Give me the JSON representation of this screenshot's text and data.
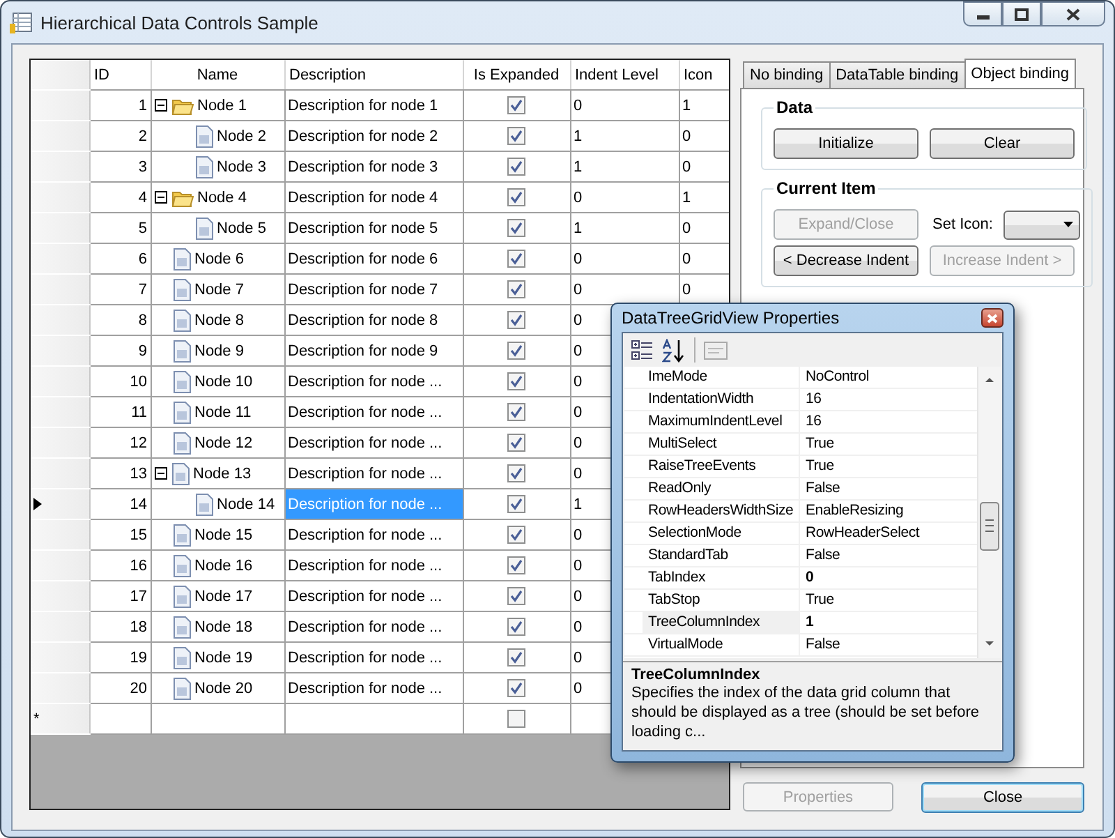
{
  "window": {
    "title": "Hierarchical Data Controls Sample"
  },
  "grid": {
    "columns": [
      "ID",
      "Name",
      "Description",
      "Is Expanded",
      "Indent Level",
      "Icon"
    ],
    "rows": [
      {
        "id": "1",
        "name": "Node 1",
        "kind": "folder",
        "expanded": true,
        "description": "Description for node 1",
        "is_expanded": true,
        "indent_level": "0",
        "icon": "1",
        "selected": false,
        "children": [
          {
            "id": "2",
            "name": "Node 2",
            "kind": "document",
            "description": "Description for node 2",
            "is_expanded": true,
            "indent_level": "1",
            "icon": "0",
            "selected": false
          },
          {
            "id": "3",
            "name": "Node 3",
            "kind": "document",
            "description": "Description for node 3",
            "is_expanded": true,
            "indent_level": "1",
            "icon": "0",
            "selected": false
          }
        ]
      },
      {
        "id": "4",
        "name": "Node 4",
        "kind": "folder",
        "expanded": true,
        "description": "Description for node 4",
        "is_expanded": true,
        "indent_level": "0",
        "icon": "1",
        "selected": false,
        "children": [
          {
            "id": "5",
            "name": "Node 5",
            "kind": "document",
            "description": "Description for node 5",
            "is_expanded": true,
            "indent_level": "1",
            "icon": "0",
            "selected": false
          }
        ]
      },
      {
        "id": "6",
        "name": "Node 6",
        "kind": "document",
        "description": "Description for node 6",
        "is_expanded": true,
        "indent_level": "0",
        "icon": "0",
        "selected": false
      },
      {
        "id": "7",
        "name": "Node 7",
        "kind": "document",
        "description": "Description for node 7",
        "is_expanded": true,
        "indent_level": "0",
        "icon": "0",
        "selected": false
      },
      {
        "id": "8",
        "name": "Node 8",
        "kind": "document",
        "description": "Description for node 8",
        "is_expanded": true,
        "indent_level": "0",
        "selected": false
      },
      {
        "id": "9",
        "name": "Node 9",
        "kind": "document",
        "description": "Description for node 9",
        "is_expanded": true,
        "indent_level": "0",
        "selected": false
      },
      {
        "id": "10",
        "name": "Node 10",
        "kind": "document",
        "description": "Description for node ...",
        "is_expanded": true,
        "indent_level": "0",
        "selected": false
      },
      {
        "id": "11",
        "name": "Node 11",
        "kind": "document",
        "description": "Description for node ...",
        "is_expanded": true,
        "indent_level": "0",
        "selected": false
      },
      {
        "id": "12",
        "name": "Node 12",
        "kind": "document",
        "description": "Description for node ...",
        "is_expanded": true,
        "indent_level": "0",
        "selected": false
      },
      {
        "id": "13",
        "name": "Node 13",
        "kind": "document",
        "expanded": true,
        "description": "Description for node ...",
        "is_expanded": true,
        "indent_level": "0",
        "selected": false,
        "children": [
          {
            "id": "14",
            "name": "Node 14",
            "kind": "document",
            "description": "Description for node ...",
            "is_expanded": true,
            "indent_level": "1",
            "selected": true
          }
        ]
      },
      {
        "id": "15",
        "name": "Node 15",
        "kind": "document",
        "description": "Description for node ...",
        "is_expanded": true,
        "indent_level": "0",
        "selected": false
      },
      {
        "id": "16",
        "name": "Node 16",
        "kind": "document",
        "description": "Description for node ...",
        "is_expanded": true,
        "indent_level": "0",
        "selected": false
      },
      {
        "id": "17",
        "name": "Node 17",
        "kind": "document",
        "description": "Description for node ...",
        "is_expanded": true,
        "indent_level": "0",
        "selected": false
      },
      {
        "id": "18",
        "name": "Node 18",
        "kind": "document",
        "description": "Description for node ...",
        "is_expanded": true,
        "indent_level": "0",
        "selected": false
      },
      {
        "id": "19",
        "name": "Node 19",
        "kind": "document",
        "description": "Description for node ...",
        "is_expanded": true,
        "indent_level": "0",
        "selected": false
      },
      {
        "id": "20",
        "name": "Node 20",
        "kind": "document",
        "description": "Description for node ...",
        "is_expanded": true,
        "indent_level": "0",
        "selected": false
      }
    ],
    "new_row": {
      "marker": "*",
      "is_expanded": false
    }
  },
  "tabs": [
    {
      "label": "No binding",
      "selected": false
    },
    {
      "label": "DataTable binding",
      "selected": false
    },
    {
      "label": "Object binding",
      "selected": true
    }
  ],
  "data_group": {
    "title": "Data",
    "buttons": [
      {
        "label": "Initialize",
        "disabled": false
      },
      {
        "label": "Clear",
        "disabled": false
      }
    ]
  },
  "current_item_group": {
    "title": "Current Item",
    "expand_button": {
      "label": "Expand/Close",
      "disabled": true
    },
    "set_icon_label": "Set Icon:",
    "decrease_button": {
      "label": "< Decrease Indent",
      "disabled": false
    },
    "increase_button": {
      "label": "Increase Indent >",
      "disabled": true
    }
  },
  "footer_buttons": [
    {
      "label": "Properties",
      "disabled": true
    },
    {
      "label": "Close",
      "disabled": false
    }
  ],
  "properties_window": {
    "title": "DataTreeGridView Properties",
    "properties": [
      {
        "name": "ImeMode",
        "value": "NoControl",
        "modified": false,
        "selected": false
      },
      {
        "name": "IndentationWidth",
        "value": "16",
        "modified": false,
        "selected": false
      },
      {
        "name": "MaximumIndentLevel",
        "value": "16",
        "modified": false,
        "selected": false
      },
      {
        "name": "MultiSelect",
        "value": "True",
        "modified": false,
        "selected": false
      },
      {
        "name": "RaiseTreeEvents",
        "value": "True",
        "modified": false,
        "selected": false
      },
      {
        "name": "ReadOnly",
        "value": "False",
        "modified": false,
        "selected": false
      },
      {
        "name": "RowHeadersWidthSize",
        "value": "EnableResizing",
        "modified": false,
        "selected": false
      },
      {
        "name": "SelectionMode",
        "value": "RowHeaderSelect",
        "modified": false,
        "selected": false
      },
      {
        "name": "StandardTab",
        "value": "False",
        "modified": false,
        "selected": false
      },
      {
        "name": "TabIndex",
        "value": "0",
        "modified": true,
        "selected": false
      },
      {
        "name": "TabStop",
        "value": "True",
        "modified": false,
        "selected": false
      },
      {
        "name": "TreeColumnIndex",
        "value": "1",
        "modified": true,
        "selected": true
      },
      {
        "name": "VirtualMode",
        "value": "False",
        "modified": false,
        "selected": false
      }
    ],
    "description_title": "TreeColumnIndex",
    "description": "Specifies the index of the data grid column that should be displayed as a tree (should be set before loading c..."
  }
}
